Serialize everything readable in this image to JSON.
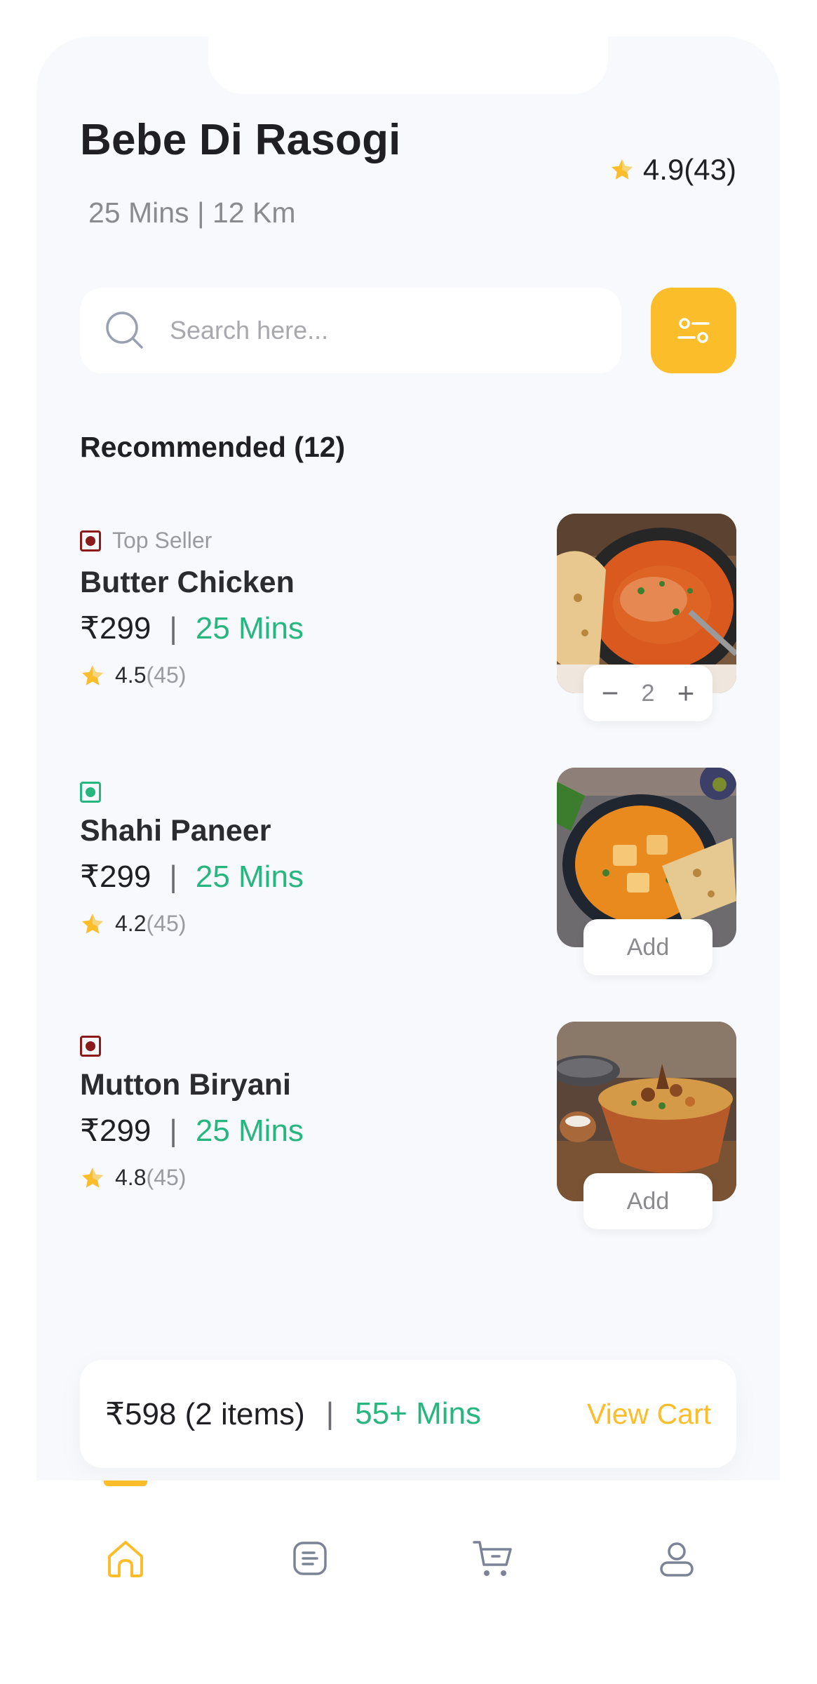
{
  "header": {
    "title": "Bebe Di Rasogi",
    "subtitle": "25 Mins | 12 Km",
    "rating": "4.9(43)"
  },
  "search": {
    "placeholder": "Search here..."
  },
  "section": {
    "title": "Recommended (12)"
  },
  "items": [
    {
      "tag": "Top Seller",
      "name": "Butter Chicken",
      "price": "₹299",
      "separator": "|",
      "time": "25 Mins",
      "rating": "4.5",
      "rating_count": "(45)",
      "type": "non-veg",
      "quantity": "2",
      "minus": "−",
      "plus": "+"
    },
    {
      "tag": "",
      "name": "Shahi Paneer",
      "price": "₹299",
      "separator": "|",
      "time": "25 Mins",
      "rating": "4.2",
      "rating_count": "(45)",
      "type": "veg",
      "add_label": "Add"
    },
    {
      "tag": "",
      "name": "Mutton Biryani",
      "price": "₹299",
      "separator": "|",
      "time": "25 Mins",
      "rating": "4.8",
      "rating_count": "(45)",
      "type": "non-veg",
      "add_label": "Add"
    }
  ],
  "cart": {
    "total": "₹598 (2 items)",
    "separator": "|",
    "time": "55+ Mins",
    "action": "View Cart"
  },
  "nav": {
    "items": [
      "home-icon",
      "menu-icon",
      "cart-icon",
      "profile-icon"
    ],
    "active": "home-icon"
  },
  "colors": {
    "accent": "#fcbd2b",
    "green": "#27b67f",
    "non_veg": "#8b1a1a",
    "veg": "#27b67f"
  }
}
